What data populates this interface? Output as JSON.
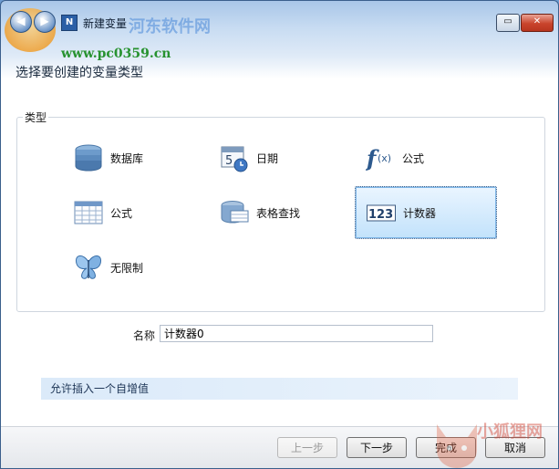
{
  "window": {
    "title": "新建变量",
    "subtitle": "选择要创建的变量类型",
    "watermark_site": "www.pc0359.cn",
    "watermark_brand": "河东软件网",
    "corner_watermark": "小狐狸网"
  },
  "group": {
    "label": "类型",
    "items": [
      {
        "label": "数据库",
        "icon": "database-icon",
        "selected": false
      },
      {
        "label": "日期",
        "icon": "calendar-clock-icon",
        "selected": false
      },
      {
        "label": "公式",
        "icon": "function-fx-icon",
        "selected": false
      },
      {
        "label": "公式",
        "icon": "table-grid-icon",
        "selected": false
      },
      {
        "label": "表格查找",
        "icon": "table-lookup-icon",
        "selected": false
      },
      {
        "label": "计数器",
        "icon": "counter-123-icon",
        "selected": true
      },
      {
        "label": "无限制",
        "icon": "butterfly-icon",
        "selected": false
      }
    ]
  },
  "name_field": {
    "label": "名称",
    "value": "计数器0"
  },
  "hint": "允许插入一个自增值",
  "buttons": {
    "prev": "上一步",
    "next": "下一步",
    "finish": "完成",
    "cancel": "取消"
  },
  "colors": {
    "selection_bg": "#c2e2fb",
    "hint_bg": "#dbeaf9",
    "watermark_green": "#27922f"
  }
}
